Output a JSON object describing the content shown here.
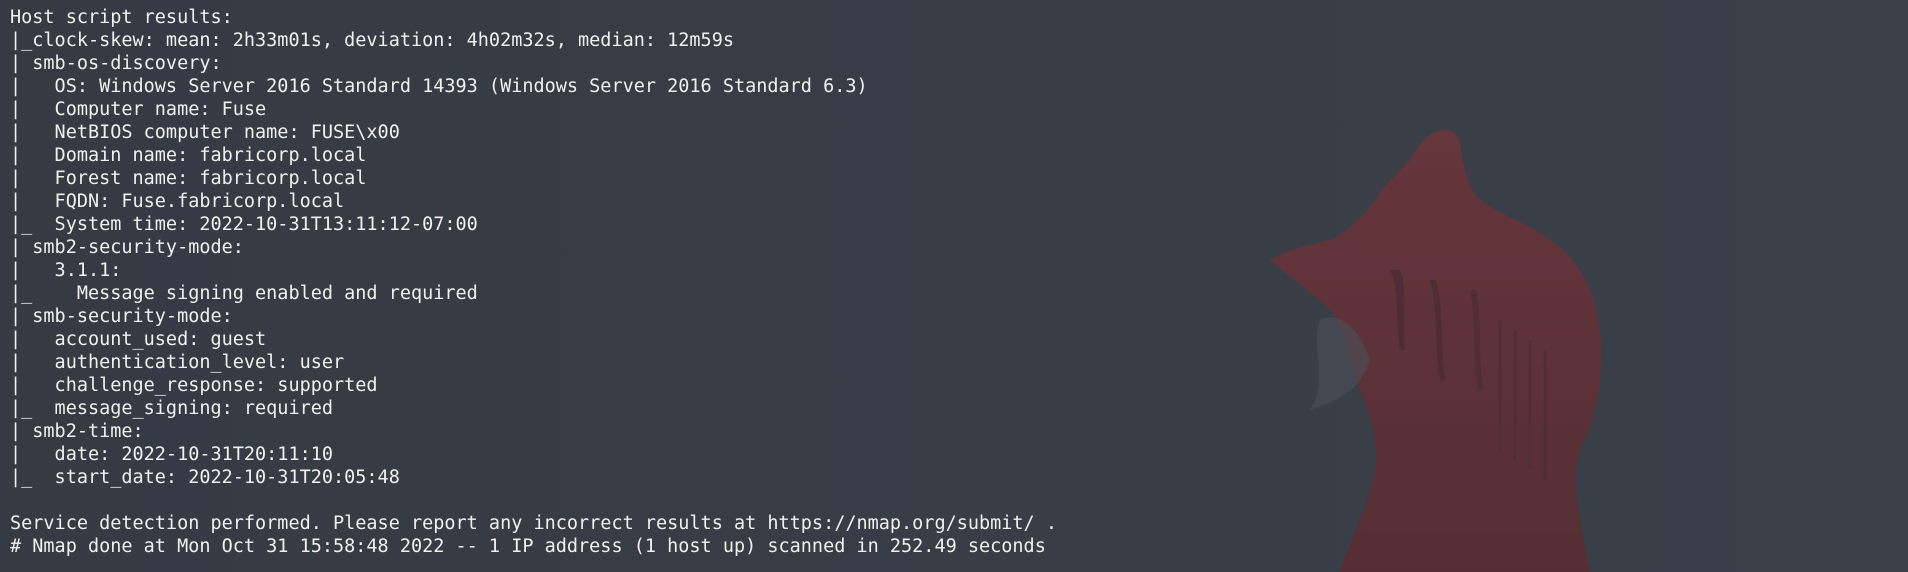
{
  "terminal": {
    "lines": [
      "Host script results:",
      "|_clock-skew: mean: 2h33m01s, deviation: 4h02m32s, median: 12m59s",
      "| smb-os-discovery:",
      "|   OS: Windows Server 2016 Standard 14393 (Windows Server 2016 Standard 6.3)",
      "|   Computer name: Fuse",
      "|   NetBIOS computer name: FUSE\\x00",
      "|   Domain name: fabricorp.local",
      "|   Forest name: fabricorp.local",
      "|   FQDN: Fuse.fabricorp.local",
      "|_  System time: 2022-10-31T13:11:12-07:00",
      "| smb2-security-mode:",
      "|   3.1.1:",
      "|_    Message signing enabled and required",
      "| smb-security-mode:",
      "|   account_used: guest",
      "|   authentication_level: user",
      "|   challenge_response: supported",
      "|_  message_signing: required",
      "| smb2-time:",
      "|   date: 2022-10-31T20:11:10",
      "|_  start_date: 2022-10-31T20:05:48",
      "",
      "Service detection performed. Please report any incorrect results at https://nmap.org/submit/ .",
      "# Nmap done at Mon Oct 31 15:58:48 2022 -- 1 IP address (1 host up) scanned in 252.49 seconds"
    ]
  },
  "colors": {
    "background": "#363b44",
    "text": "#f0f0f0",
    "wallpaper_fox": "#7a2a2e"
  },
  "icons": {
    "wallpaper": "fox-silhouette-icon"
  }
}
